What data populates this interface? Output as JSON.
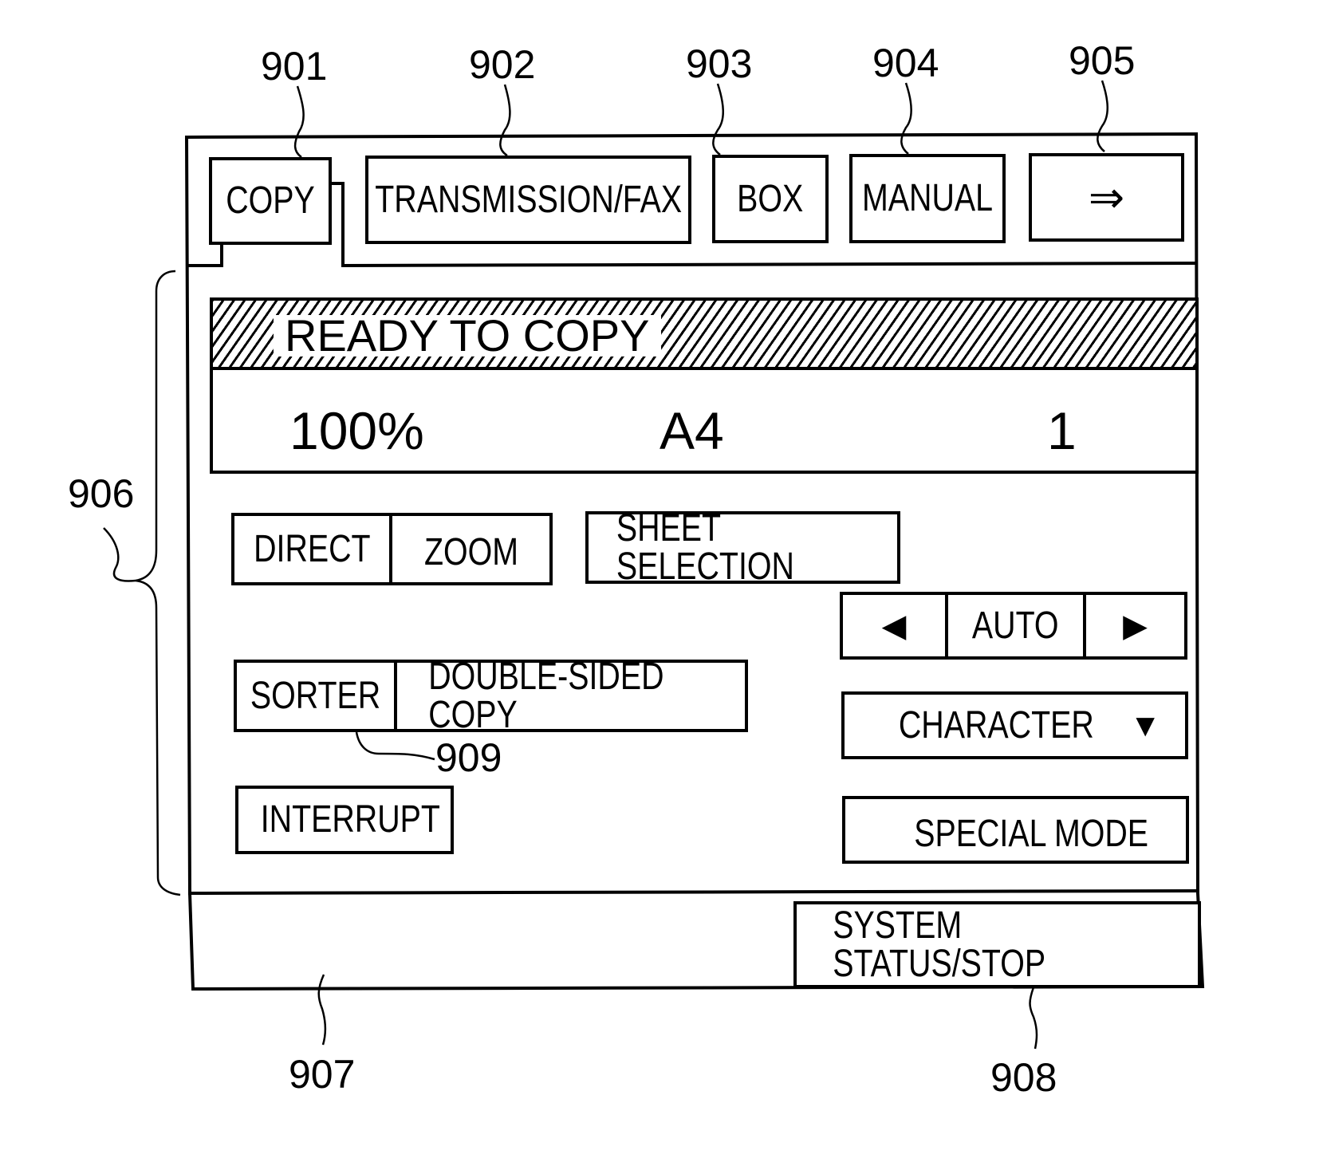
{
  "tabs": [
    {
      "label": "COPY",
      "ref": "901",
      "active": true
    },
    {
      "label": "TRANSMISSION/FAX",
      "ref": "902"
    },
    {
      "label": "BOX",
      "ref": "903"
    },
    {
      "label": "MANUAL",
      "ref": "904"
    },
    {
      "label": "⇒",
      "ref": "905",
      "icon": "double-arrow-right-icon"
    }
  ],
  "status": {
    "message": "READY TO COPY",
    "zoom_ratio": "100%",
    "paper_size": "A4",
    "copy_count": "1"
  },
  "controls": {
    "direct_label": "DIRECT",
    "zoom_label": "ZOOM",
    "sheet_selection_label": "SHEET SELECTION",
    "density": {
      "left_icon": "◀",
      "value": "AUTO",
      "right_icon": "▶"
    },
    "original_type": {
      "value": "CHARACTER",
      "dropdown_icon": "▼"
    },
    "sorter_label": "SORTER",
    "double_sided_label": "DOUBLE-SIDED COPY",
    "interrupt_label": "INTERRUPT",
    "special_mode_label": "SPECIAL MODE"
  },
  "footer": {
    "system_status_label": "SYSTEM STATUS/STOP"
  },
  "reference_numerals": {
    "copy_tab": "901",
    "fax_tab": "902",
    "box_tab": "903",
    "manual_tab": "904",
    "next_tab": "905",
    "operation_area": "906",
    "status_area": "907",
    "system_status_button": "908",
    "sorter_button": "909"
  }
}
